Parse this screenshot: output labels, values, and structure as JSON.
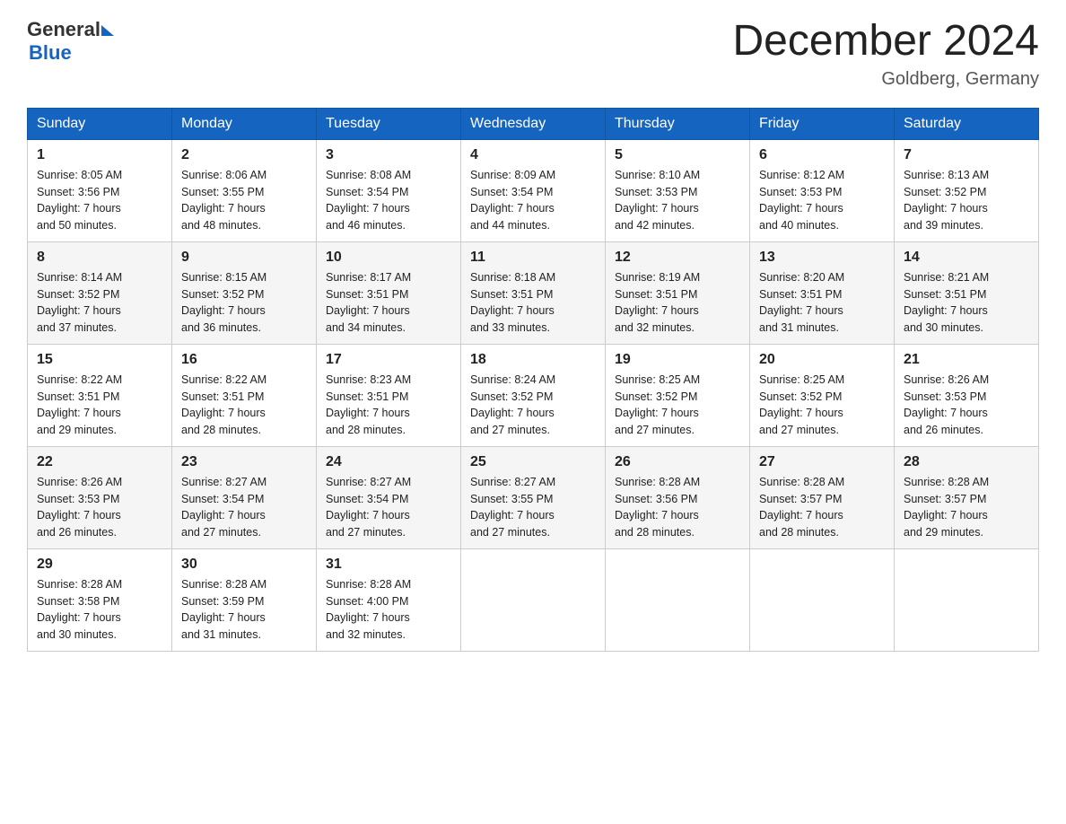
{
  "header": {
    "logo_general": "General",
    "logo_blue": "Blue",
    "month_title": "December 2024",
    "location": "Goldberg, Germany"
  },
  "days_of_week": [
    "Sunday",
    "Monday",
    "Tuesday",
    "Wednesday",
    "Thursday",
    "Friday",
    "Saturday"
  ],
  "weeks": [
    [
      {
        "day": "1",
        "sunrise": "8:05 AM",
        "sunset": "3:56 PM",
        "daylight": "7 hours and 50 minutes."
      },
      {
        "day": "2",
        "sunrise": "8:06 AM",
        "sunset": "3:55 PM",
        "daylight": "7 hours and 48 minutes."
      },
      {
        "day": "3",
        "sunrise": "8:08 AM",
        "sunset": "3:54 PM",
        "daylight": "7 hours and 46 minutes."
      },
      {
        "day": "4",
        "sunrise": "8:09 AM",
        "sunset": "3:54 PM",
        "daylight": "7 hours and 44 minutes."
      },
      {
        "day": "5",
        "sunrise": "8:10 AM",
        "sunset": "3:53 PM",
        "daylight": "7 hours and 42 minutes."
      },
      {
        "day": "6",
        "sunrise": "8:12 AM",
        "sunset": "3:53 PM",
        "daylight": "7 hours and 40 minutes."
      },
      {
        "day": "7",
        "sunrise": "8:13 AM",
        "sunset": "3:52 PM",
        "daylight": "7 hours and 39 minutes."
      }
    ],
    [
      {
        "day": "8",
        "sunrise": "8:14 AM",
        "sunset": "3:52 PM",
        "daylight": "7 hours and 37 minutes."
      },
      {
        "day": "9",
        "sunrise": "8:15 AM",
        "sunset": "3:52 PM",
        "daylight": "7 hours and 36 minutes."
      },
      {
        "day": "10",
        "sunrise": "8:17 AM",
        "sunset": "3:51 PM",
        "daylight": "7 hours and 34 minutes."
      },
      {
        "day": "11",
        "sunrise": "8:18 AM",
        "sunset": "3:51 PM",
        "daylight": "7 hours and 33 minutes."
      },
      {
        "day": "12",
        "sunrise": "8:19 AM",
        "sunset": "3:51 PM",
        "daylight": "7 hours and 32 minutes."
      },
      {
        "day": "13",
        "sunrise": "8:20 AM",
        "sunset": "3:51 PM",
        "daylight": "7 hours and 31 minutes."
      },
      {
        "day": "14",
        "sunrise": "8:21 AM",
        "sunset": "3:51 PM",
        "daylight": "7 hours and 30 minutes."
      }
    ],
    [
      {
        "day": "15",
        "sunrise": "8:22 AM",
        "sunset": "3:51 PM",
        "daylight": "7 hours and 29 minutes."
      },
      {
        "day": "16",
        "sunrise": "8:22 AM",
        "sunset": "3:51 PM",
        "daylight": "7 hours and 28 minutes."
      },
      {
        "day": "17",
        "sunrise": "8:23 AM",
        "sunset": "3:51 PM",
        "daylight": "7 hours and 28 minutes."
      },
      {
        "day": "18",
        "sunrise": "8:24 AM",
        "sunset": "3:52 PM",
        "daylight": "7 hours and 27 minutes."
      },
      {
        "day": "19",
        "sunrise": "8:25 AM",
        "sunset": "3:52 PM",
        "daylight": "7 hours and 27 minutes."
      },
      {
        "day": "20",
        "sunrise": "8:25 AM",
        "sunset": "3:52 PM",
        "daylight": "7 hours and 27 minutes."
      },
      {
        "day": "21",
        "sunrise": "8:26 AM",
        "sunset": "3:53 PM",
        "daylight": "7 hours and 26 minutes."
      }
    ],
    [
      {
        "day": "22",
        "sunrise": "8:26 AM",
        "sunset": "3:53 PM",
        "daylight": "7 hours and 26 minutes."
      },
      {
        "day": "23",
        "sunrise": "8:27 AM",
        "sunset": "3:54 PM",
        "daylight": "7 hours and 27 minutes."
      },
      {
        "day": "24",
        "sunrise": "8:27 AM",
        "sunset": "3:54 PM",
        "daylight": "7 hours and 27 minutes."
      },
      {
        "day": "25",
        "sunrise": "8:27 AM",
        "sunset": "3:55 PM",
        "daylight": "7 hours and 27 minutes."
      },
      {
        "day": "26",
        "sunrise": "8:28 AM",
        "sunset": "3:56 PM",
        "daylight": "7 hours and 28 minutes."
      },
      {
        "day": "27",
        "sunrise": "8:28 AM",
        "sunset": "3:57 PM",
        "daylight": "7 hours and 28 minutes."
      },
      {
        "day": "28",
        "sunrise": "8:28 AM",
        "sunset": "3:57 PM",
        "daylight": "7 hours and 29 minutes."
      }
    ],
    [
      {
        "day": "29",
        "sunrise": "8:28 AM",
        "sunset": "3:58 PM",
        "daylight": "7 hours and 30 minutes."
      },
      {
        "day": "30",
        "sunrise": "8:28 AM",
        "sunset": "3:59 PM",
        "daylight": "7 hours and 31 minutes."
      },
      {
        "day": "31",
        "sunrise": "8:28 AM",
        "sunset": "4:00 PM",
        "daylight": "7 hours and 32 minutes."
      },
      {
        "day": "",
        "sunrise": "",
        "sunset": "",
        "daylight": ""
      },
      {
        "day": "",
        "sunrise": "",
        "sunset": "",
        "daylight": ""
      },
      {
        "day": "",
        "sunrise": "",
        "sunset": "",
        "daylight": ""
      },
      {
        "day": "",
        "sunrise": "",
        "sunset": "",
        "daylight": ""
      }
    ]
  ],
  "labels": {
    "sunrise": "Sunrise:",
    "sunset": "Sunset:",
    "daylight": "Daylight:"
  }
}
